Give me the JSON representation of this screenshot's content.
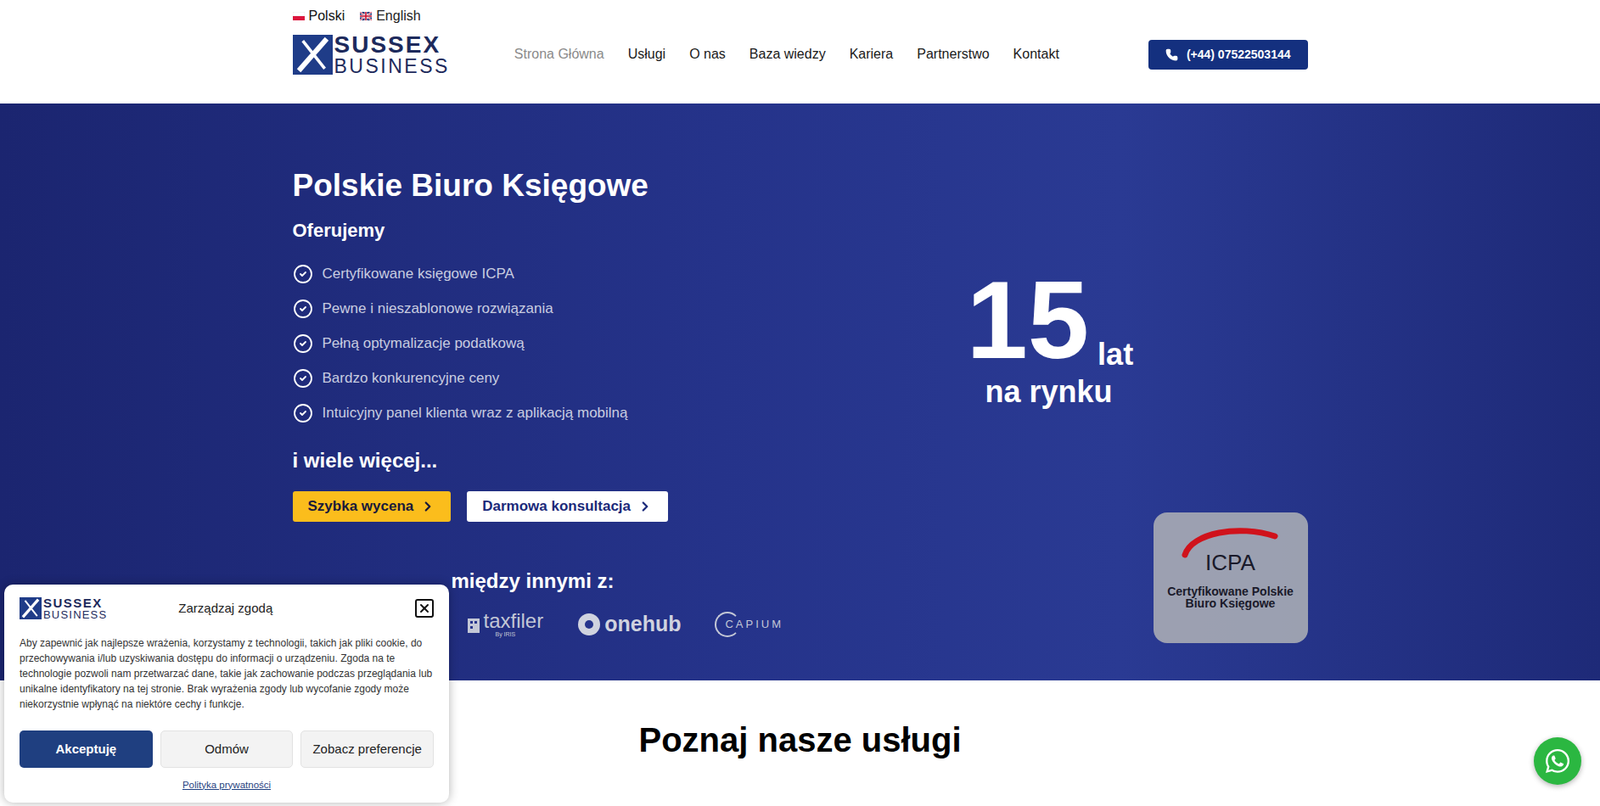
{
  "languages": [
    {
      "label": "Polski",
      "selected": true,
      "kind": "pl"
    },
    {
      "label": "English",
      "selected": false,
      "kind": "en"
    }
  ],
  "logo": {
    "line1": "SUSSEX",
    "line2": "BUSINESS"
  },
  "nav": [
    {
      "label": "Strona Główna",
      "selected": true
    },
    {
      "label": "Usługi",
      "selected": false
    },
    {
      "label": "O nas",
      "selected": false
    },
    {
      "label": "Baza wiedzy",
      "selected": false
    },
    {
      "label": "Kariera",
      "selected": false
    },
    {
      "label": "Partnerstwo",
      "selected": false
    },
    {
      "label": "Kontakt",
      "selected": false
    }
  ],
  "phone": "(+44) 07522503144",
  "hero": {
    "title": "Polskie Biuro Księgowe",
    "subtitle": "Oferujemy",
    "features": [
      "Certyfikowane księgowe ICPA",
      "Pewne i nieszablonowe rozwiązania",
      "Pełną optymalizacje podatkową",
      "Bardzo konkurencyjne ceny",
      "Intuicyjny panel klienta wraz z aplikacją mobilną"
    ],
    "more": "i wiele więcej...",
    "buttons": [
      {
        "label": "Szybka wycena",
        "kind": "primary"
      },
      {
        "label": "Darmowa konsultacja",
        "kind": "secondary"
      }
    ],
    "partners_heading": "między innymi z:",
    "partners": [
      {
        "name": "taxfiler",
        "sub": "By IRIS",
        "kind": "taxfiler"
      },
      {
        "name": "onehub",
        "kind": "onehub"
      },
      {
        "name": "CAPIUM",
        "kind": "capium"
      }
    ],
    "years": "15",
    "years_unit": "lat",
    "years_caption": "na rynku",
    "badge": {
      "logo": "ICPA",
      "caption": "Certyfikowane Polskie Biuro Księgowe"
    }
  },
  "services_heading": "Poznaj nasze usługi",
  "cookie": {
    "logo": {
      "line1": "SUSSEX",
      "line2": "BUSINESS"
    },
    "title": "Zarządzaj zgodą",
    "body": "Aby zapewnić jak najlepsze wrażenia, korzystamy z technologii, takich jak pliki cookie, do przechowywania i/lub uzyskiwania dostępu do informacji o urządzeniu. Zgoda na te technologie pozwoli nam przetwarzać dane, takie jak zachowanie podczas przeglądania lub unikalne identyfikatory na tej stronie. Brak wyrażenia zgody lub wycofanie zgody może niekorzystnie wpłynąć na niektóre cechy i funkcje.",
    "buttons": [
      {
        "label": "Akceptuję",
        "kind": "primary"
      },
      {
        "label": "Odmów",
        "kind": "secondary"
      },
      {
        "label": "Zobacz preferencje",
        "kind": "secondary"
      }
    ],
    "link": "Polityka prywatności"
  }
}
